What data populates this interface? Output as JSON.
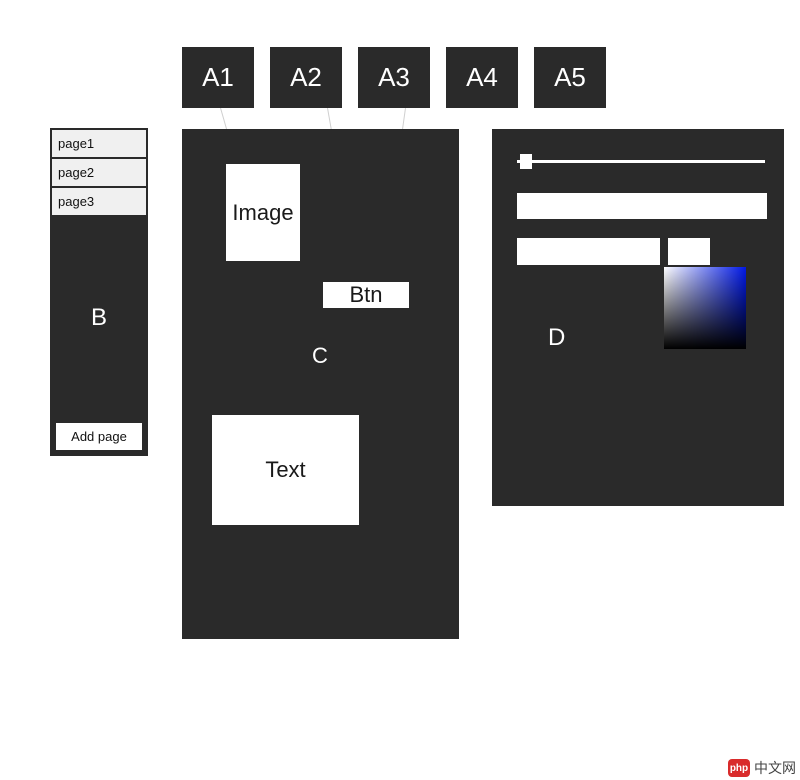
{
  "tabs": [
    "A1",
    "A2",
    "A3",
    "A4",
    "A5"
  ],
  "sidebar": {
    "pages": [
      "page1",
      "page2",
      "page3"
    ],
    "label": "B",
    "add_label": "Add page"
  },
  "canvas": {
    "label": "C",
    "widgets": {
      "image": "Image",
      "button": "Btn",
      "text": "Text"
    }
  },
  "props": {
    "label": "D"
  },
  "watermark": {
    "icon_text": "php",
    "text": "中文网"
  }
}
